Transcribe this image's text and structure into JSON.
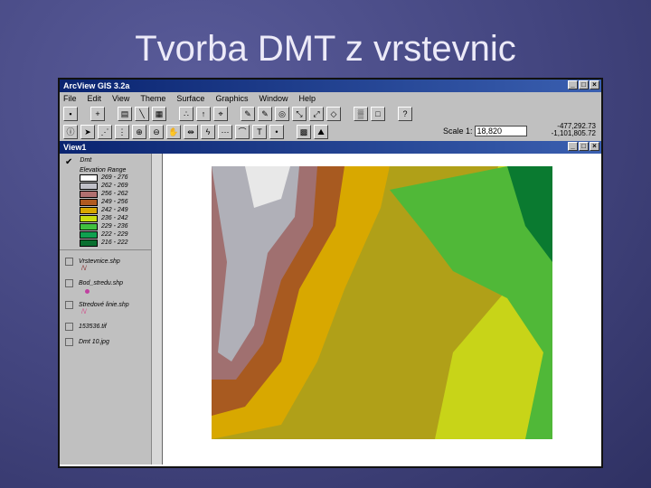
{
  "slide_title": "Tvorba DMT z vrstevnic",
  "app": {
    "title": "ArcView GIS 3.2a",
    "menu": [
      "File",
      "Edit",
      "View",
      "Theme",
      "Surface",
      "Graphics",
      "Window",
      "Help"
    ]
  },
  "scale": {
    "label": "Scale 1:",
    "value": "18,820",
    "x": "-477,292.73",
    "y": "-1,101,805.72"
  },
  "view": {
    "title": "View1",
    "theme": "Dmt",
    "legend_title": "Elevation Range",
    "legend": [
      {
        "range": "269 - 276",
        "color": "#ffffff"
      },
      {
        "range": "262 - 269",
        "color": "#c0c0c8"
      },
      {
        "range": "256 - 262",
        "color": "#b07070"
      },
      {
        "range": "249 - 256",
        "color": "#b05a20"
      },
      {
        "range": "242 - 249",
        "color": "#d8a800"
      },
      {
        "range": "236 - 242",
        "color": "#c8e010"
      },
      {
        "range": "229 - 236",
        "color": "#40c040"
      },
      {
        "range": "222 - 229",
        "color": "#10a050"
      },
      {
        "range": "216 - 222",
        "color": "#0a7030"
      }
    ],
    "layers": [
      "Vrstevnice.shp",
      "Bod_stredu.shp",
      "Stredové linie.shp",
      "153536.tif",
      "Dmt 10.jpg"
    ]
  }
}
